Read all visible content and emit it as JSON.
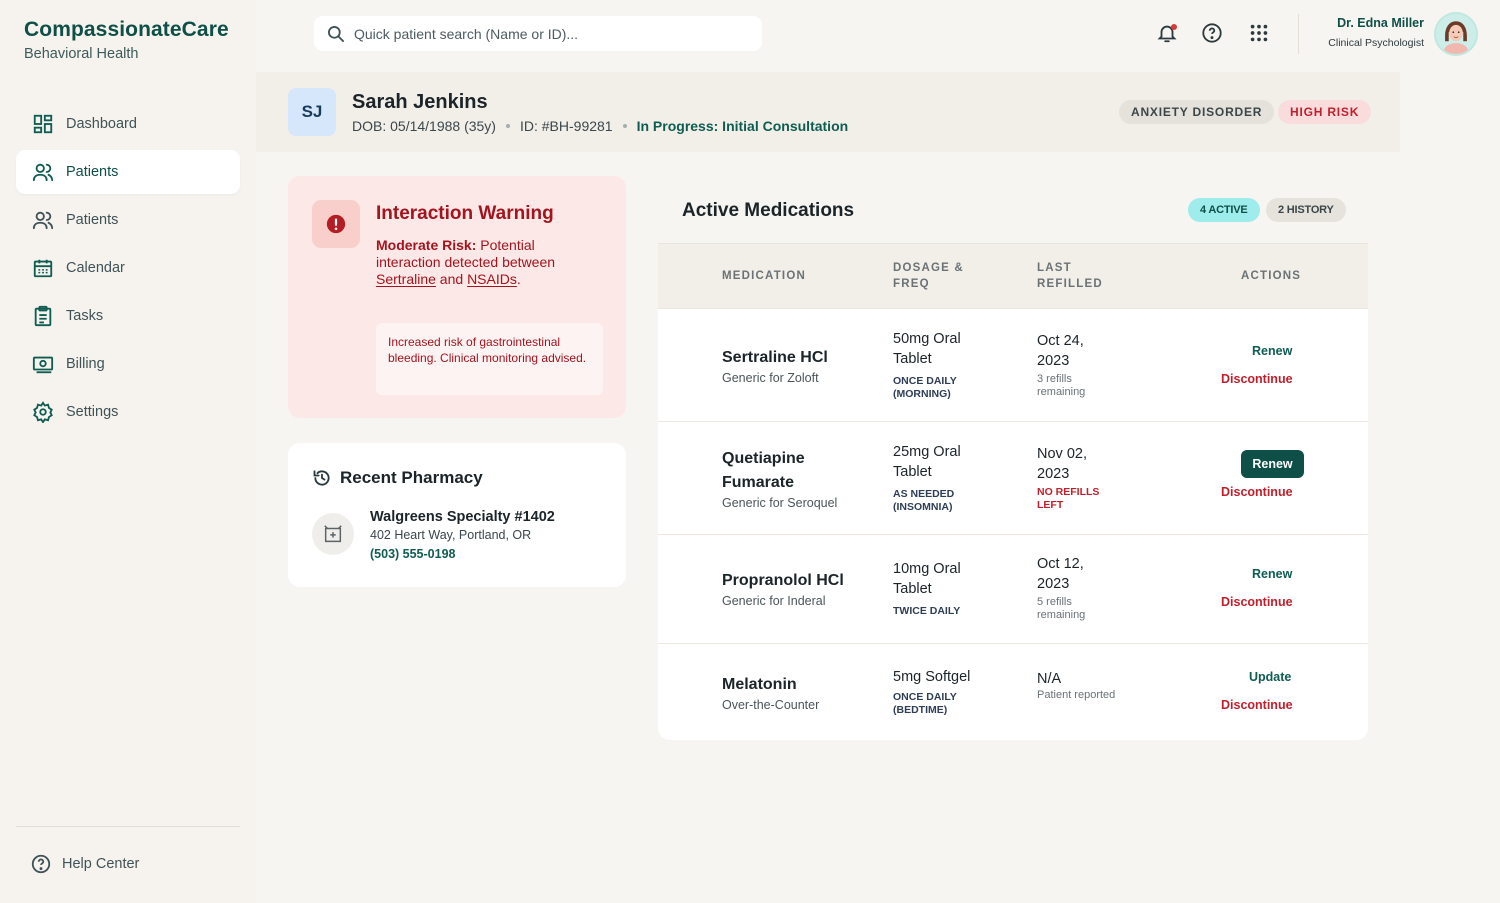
{
  "brand": {
    "name": "CompassionateCare",
    "subtitle": "Behavioral Health"
  },
  "nav": [
    {
      "label": "Dashboard",
      "icon": "dashboard-icon",
      "active": false
    },
    {
      "label": "Patients",
      "icon": "users-icon",
      "active": true
    },
    {
      "label": "Patients",
      "icon": "users-icon",
      "active": false
    },
    {
      "label": "Calendar",
      "icon": "calendar-icon",
      "active": false
    },
    {
      "label": "Tasks",
      "icon": "clipboard-icon",
      "active": false
    },
    {
      "label": "Billing",
      "icon": "billing-icon",
      "active": false
    },
    {
      "label": "Settings",
      "icon": "gear-icon",
      "active": false
    }
  ],
  "help": {
    "label": "Help Center",
    "icon": "help-icon"
  },
  "search": {
    "placeholder": "Quick patient search (Name or ID)...",
    "icon": "search-icon"
  },
  "topbar_icons": [
    "bell-icon",
    "help-circle-icon",
    "apps-grid-icon"
  ],
  "user": {
    "name": "Dr. Edna Miller",
    "role": "Clinical Psychologist"
  },
  "patient": {
    "initials": "SJ",
    "name": "Sarah Jenkins",
    "dob": "DOB: 05/14/1988 (35y)",
    "id": "ID: #BH-99281",
    "status": "In Progress: Initial Consultation",
    "tags": {
      "diagnosis": "ANXIETY DISORDER",
      "risk": "HIGH RISK"
    }
  },
  "warning": {
    "title": "Interaction Warning",
    "risk_label": "Moderate Risk:",
    "text_1": " Potential interaction detected between ",
    "drug_1": "Sertraline",
    "text_2": " and ",
    "drug_2": "NSAIDs",
    "text_3": ".",
    "note": "Increased risk of gastrointestinal bleeding. Clinical monitoring advised.",
    "icon": "alert-icon"
  },
  "pharmacy": {
    "title": "Recent Pharmacy",
    "title_icon": "history-icon",
    "name": "Walgreens Specialty #1402",
    "address": "402 Heart Way, Portland, OR",
    "phone": "(503) 555-0198",
    "icon": "pharmacy-icon"
  },
  "medications": {
    "title": "Active Medications",
    "active_badge": "4 ACTIVE",
    "history_badge": "2 HISTORY",
    "columns": {
      "medication": "MEDICATION",
      "dosage": "DOSAGE & FREQ",
      "refilled": "LAST REFILLED",
      "actions": "ACTIONS"
    },
    "rows": [
      {
        "name": "Sertraline HCl",
        "generic": "Generic for Zoloft",
        "dose": "50mg Oral Tablet",
        "freq": "ONCE DAILY (MORNING)",
        "date": "Oct 24, 2023",
        "refill": "3 refills remaining",
        "primary": "Renew",
        "discontinue": "Discontinue"
      },
      {
        "name": "Quetiapine Fumarate",
        "generic": "Generic for Seroquel",
        "dose": "25mg Oral Tablet",
        "freq": "AS NEEDED (INSOMNIA)",
        "date": "Nov 02, 2023",
        "refill": "NO REFILLS LEFT",
        "primary": "Renew",
        "discontinue": "Discontinue"
      },
      {
        "name": "Propranolol HCl",
        "generic": "Generic for Inderal",
        "dose": "10mg Oral Tablet",
        "freq": "TWICE DAILY",
        "date": "Oct 12, 2023",
        "refill": "5 refills remaining",
        "primary": "Renew",
        "discontinue": "Discontinue"
      },
      {
        "name": "Melatonin",
        "generic": "Over-the-Counter",
        "dose": "5mg Softgel",
        "freq": "ONCE DAILY (BEDTIME)",
        "date": "N/A",
        "refill": "Patient reported",
        "primary": "Update",
        "discontinue": "Discontinue"
      }
    ]
  },
  "colors": {
    "brand": "#0e4f47",
    "danger": "#c21f2c",
    "warning_bg": "#fce8e6",
    "accent_badge": "#9eecec"
  }
}
